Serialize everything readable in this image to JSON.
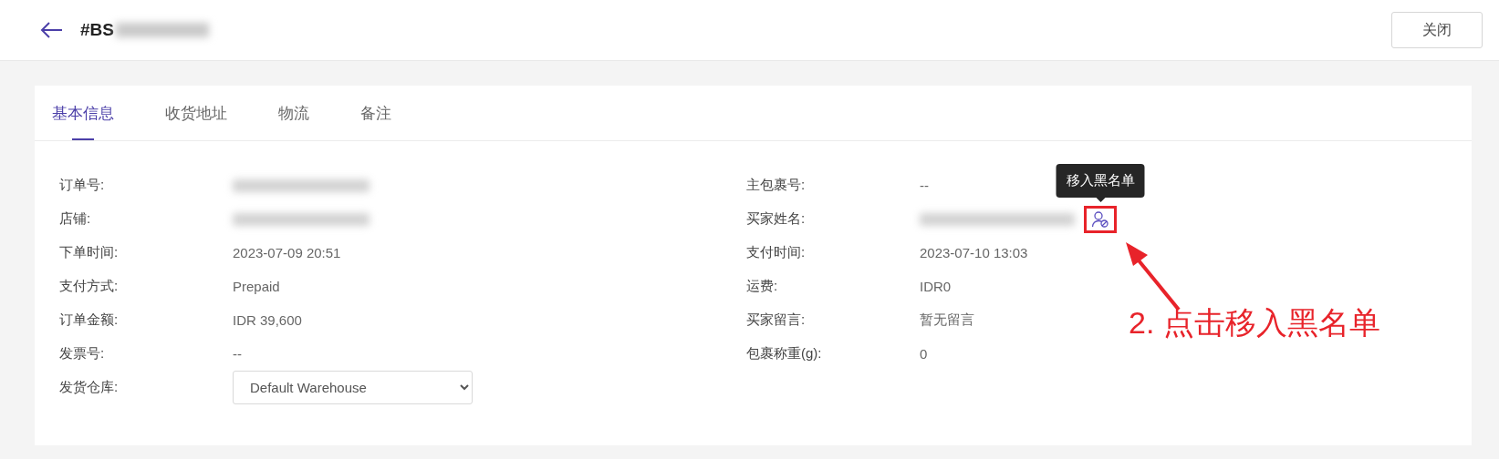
{
  "header": {
    "title": "#BS",
    "title_redacted": true,
    "close_button": "关闭"
  },
  "tabs": [
    {
      "label": "基本信息",
      "selected": true
    },
    {
      "label": "收货地址",
      "selected": false
    },
    {
      "label": "物流",
      "selected": false
    },
    {
      "label": "备注",
      "selected": false
    }
  ],
  "fields_left": [
    {
      "label": "订单号:",
      "kind": "redacted"
    },
    {
      "label": "店铺:",
      "kind": "redacted"
    },
    {
      "label": "下单时间:",
      "kind": "text",
      "value": "2023-07-09 20:51"
    },
    {
      "label": "支付方式:",
      "kind": "text",
      "value": "Prepaid"
    },
    {
      "label": "订单金额:",
      "kind": "text",
      "value": "IDR 39,600"
    },
    {
      "label": "发票号:",
      "kind": "text",
      "value": "--"
    },
    {
      "label": "发货仓库:",
      "kind": "select",
      "value": "Default Warehouse"
    }
  ],
  "fields_right": [
    {
      "label": "主包裹号:",
      "kind": "text",
      "value": "--"
    },
    {
      "label": "买家姓名:",
      "kind": "redacted",
      "action": {
        "tooltip": "移入黑名单",
        "highlighted": true
      }
    },
    {
      "label": "支付时间:",
      "kind": "text",
      "value": "2023-07-10 13:03"
    },
    {
      "label": "运费:",
      "kind": "text",
      "value": "IDR0"
    },
    {
      "label": "买家留言:",
      "kind": "text",
      "value": "暂无留言"
    },
    {
      "label": "包裹称重(g):",
      "kind": "text",
      "value": "0"
    }
  ],
  "annotation": {
    "text": "2. 点击移入黑名单"
  }
}
